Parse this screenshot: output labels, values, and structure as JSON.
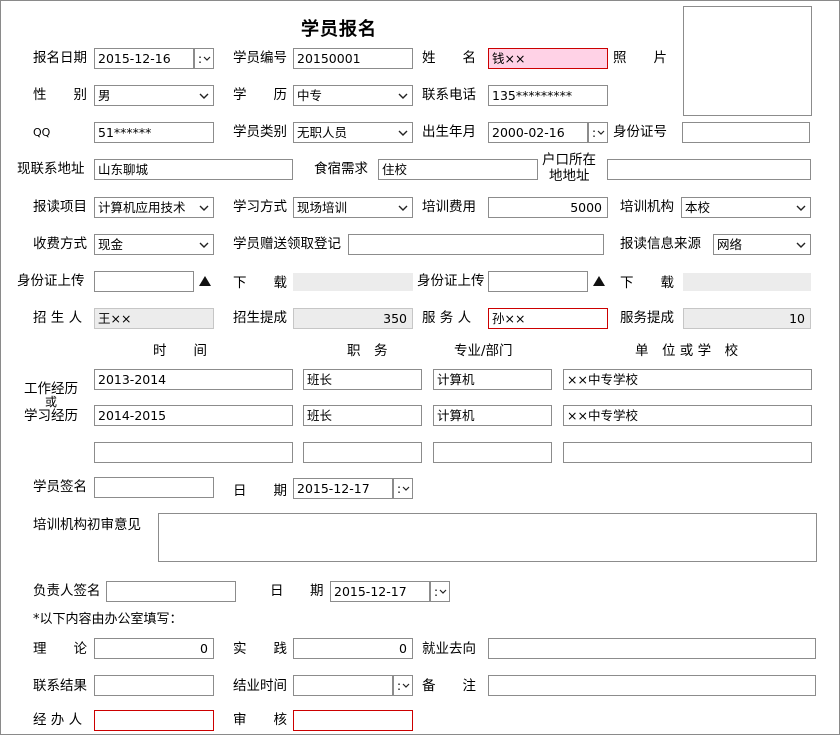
{
  "title": "学员报名",
  "labels": {
    "signup_date": "报名日期",
    "student_no": "学员编号",
    "name": "姓　　名",
    "photo": "照　　片",
    "gender": "性　　别",
    "education": "学　　历",
    "phone": "联系电话",
    "qq": "QQ",
    "student_type": "学员类别",
    "birth": "出生年月",
    "id_no": "身份证号",
    "address": "现联系地址",
    "lodging": "食宿需求",
    "hukou_line1": "户口所在",
    "hukou_line2": "地地址",
    "project": "报读项目",
    "study_mode": "学习方式",
    "fee": "培训费用",
    "org": "培训机构",
    "pay_mode": "收费方式",
    "gift_reg": "学员赠送领取登记",
    "info_source": "报读信息来源",
    "id_upload": "身份证上传",
    "download": "下　　载",
    "id_upload2": "身份证上传",
    "download2": "下　　载",
    "recruiter": "招 生 人",
    "recruit_commission": "招生提成",
    "servicer": "服 务 人",
    "service_commission": "服务提成",
    "col_time": "时　　间",
    "col_position": "职　务",
    "col_major": "专业/部门",
    "col_unit": "单　位 或 学　校",
    "exp_line1": "工作经历",
    "exp_line2": "或",
    "exp_line3": "学习经历",
    "student_sign": "学员签名",
    "date1": "日　　期",
    "org_opinion": "培训机构初审意见",
    "leader_sign": "负责人签名",
    "date2_a": "日",
    "date2_b": "期",
    "office_note": "*以下内容由办公室填写：",
    "theory": "理　　论",
    "practice": "实　　践",
    "employment": "就业去向",
    "contact_result": "联系结果",
    "finish_time": "结业时间",
    "remark": "备　　注",
    "handler": "经 办 人",
    "audit": "审　　核"
  },
  "values": {
    "signup_date": "2015-12-16",
    "student_no": "20150001",
    "name": "钱××",
    "gender": "男",
    "education": "中专",
    "phone": "135*********",
    "qq": "51******",
    "student_type": "无职人员",
    "birth": "2000-02-16",
    "id_no": "",
    "address": "山东聊城",
    "lodging": "住校",
    "hukou": "",
    "project": "计算机应用技术",
    "study_mode": "现场培训",
    "fee": "5000",
    "org": "本校",
    "pay_mode": "现金",
    "gift_reg": "",
    "info_source": "网络",
    "recruiter": "王××",
    "recruit_commission": "350",
    "servicer": "孙××",
    "service_commission": "10",
    "exp": [
      {
        "time": "2013-2014",
        "position": "班长",
        "major": "计算机",
        "unit": "××中专学校"
      },
      {
        "time": "2014-2015",
        "position": "班长",
        "major": "计算机",
        "unit": "××中专学校"
      },
      {
        "time": "",
        "position": "",
        "major": "",
        "unit": ""
      }
    ],
    "student_sign": "",
    "date1": "2015-12-17",
    "leader_sign": "",
    "date2": "2015-12-17",
    "theory": "0",
    "practice": "0",
    "employment": "",
    "contact_result": "",
    "finish_time": "",
    "remark": "",
    "handler": "",
    "audit": ""
  },
  "icons": {
    "dropdown": "chevron-down-icon",
    "spin": "colon-spin-icon",
    "upload": "triangle-up-icon"
  }
}
